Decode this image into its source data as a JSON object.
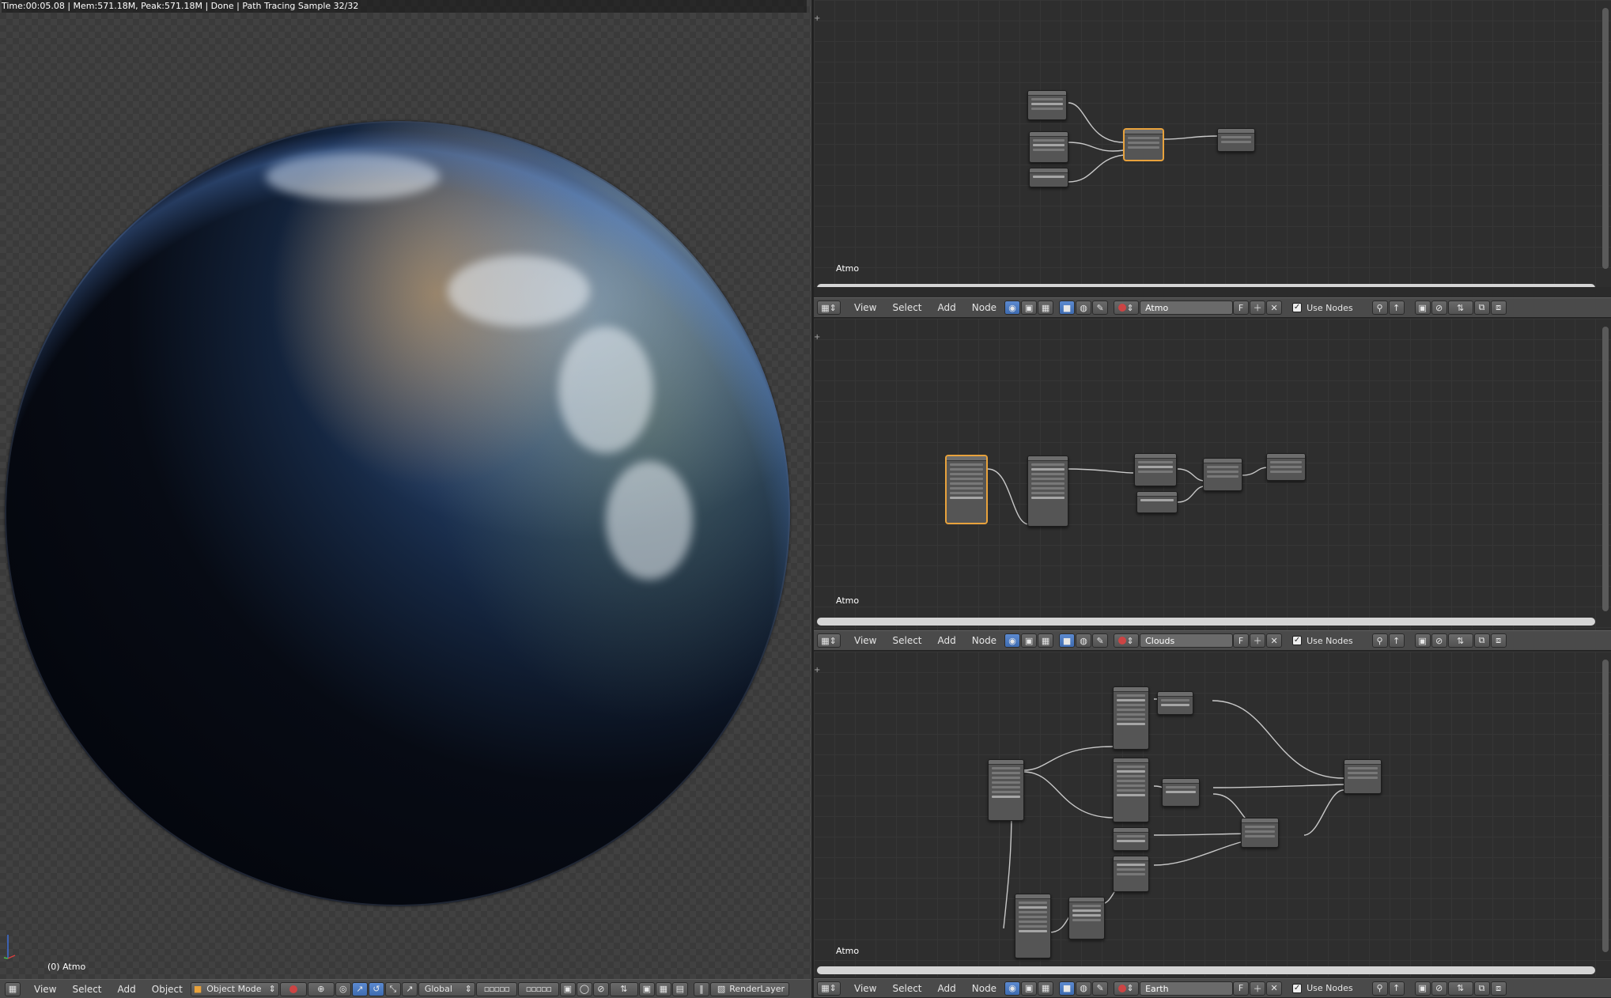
{
  "viewport": {
    "render_info": "Time:00:05.08 | Mem:571.18M, Peak:571.18M | Done | Path Tracing Sample 32/32",
    "object_label": "(0) Atmo"
  },
  "view3d_header": {
    "menus": [
      "View",
      "Select",
      "Add",
      "Object"
    ],
    "mode": "Object Mode",
    "orientation": "Global",
    "render_layer": "RenderLayer"
  },
  "node_editors": [
    {
      "label": "Atmo"
    },
    {
      "label": "Atmo",
      "header": {
        "menus": [
          "View",
          "Select",
          "Add",
          "Node"
        ],
        "material": "Atmo",
        "fake_user": "F",
        "use_nodes": "Use Nodes"
      }
    },
    {
      "label": "Atmo",
      "header": {
        "menus": [
          "View",
          "Select",
          "Add",
          "Node"
        ],
        "material": "Clouds",
        "fake_user": "F",
        "use_nodes": "Use Nodes"
      }
    },
    {
      "header": {
        "menus": [
          "View",
          "Select",
          "Add",
          "Node"
        ],
        "material": "Earth",
        "fake_user": "F",
        "use_nodes": "Use Nodes"
      }
    }
  ],
  "colors": {
    "accent_blue": "#5c8ad0",
    "selected_node": "#e8a23c",
    "header_bg": "#4a4a4a"
  },
  "icons": [
    "editor-type-icon",
    "material-sphere-icon",
    "checker-icon",
    "object-icon",
    "world-icon",
    "brush-icon",
    "pin-icon",
    "backdrop-icon",
    "snap-icon",
    "axis-gizmo-icon"
  ]
}
